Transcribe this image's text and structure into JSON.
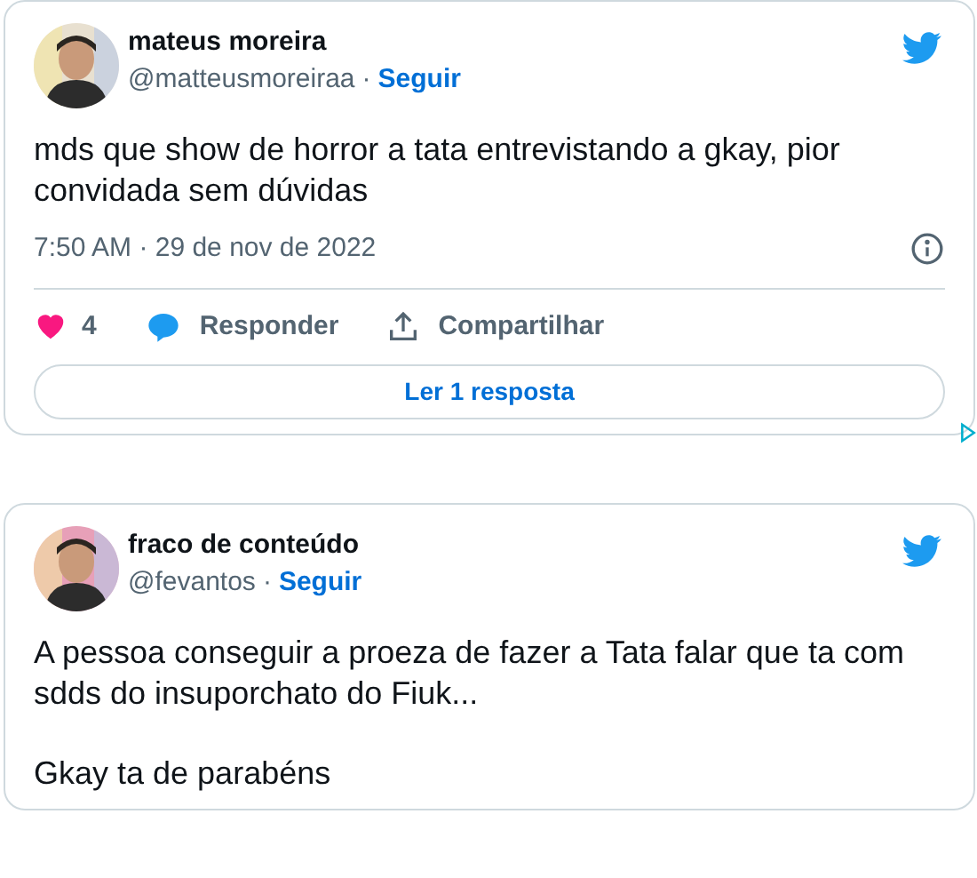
{
  "tweets": [
    {
      "name": "mateus moreira",
      "handle": "@matteusmoreiraa",
      "separator": "·",
      "follow": "Seguir",
      "paragraphs": [
        "mds que show de horror a tata entrevistando a gkay, pior convidada sem dúvidas"
      ],
      "timestamp": "7:50 AM · 29 de nov de 2022",
      "actions": {
        "likes": "4",
        "reply": "Responder",
        "share": "Compartilhar"
      },
      "read_replies": "Ler 1 resposta",
      "avatar": {
        "kind": "picture"
      }
    },
    {
      "name": "fraco de conteúdo",
      "handle": "@fevantos",
      "separator": "·",
      "follow": "Seguir",
      "paragraphs": [
        "A pessoa conseguir a proeza de fazer a Tata falar que ta com sdds do insuporchato do Fiuk...",
        "Gkay ta de parabéns"
      ],
      "avatar": {
        "kind": "picture"
      }
    }
  ]
}
